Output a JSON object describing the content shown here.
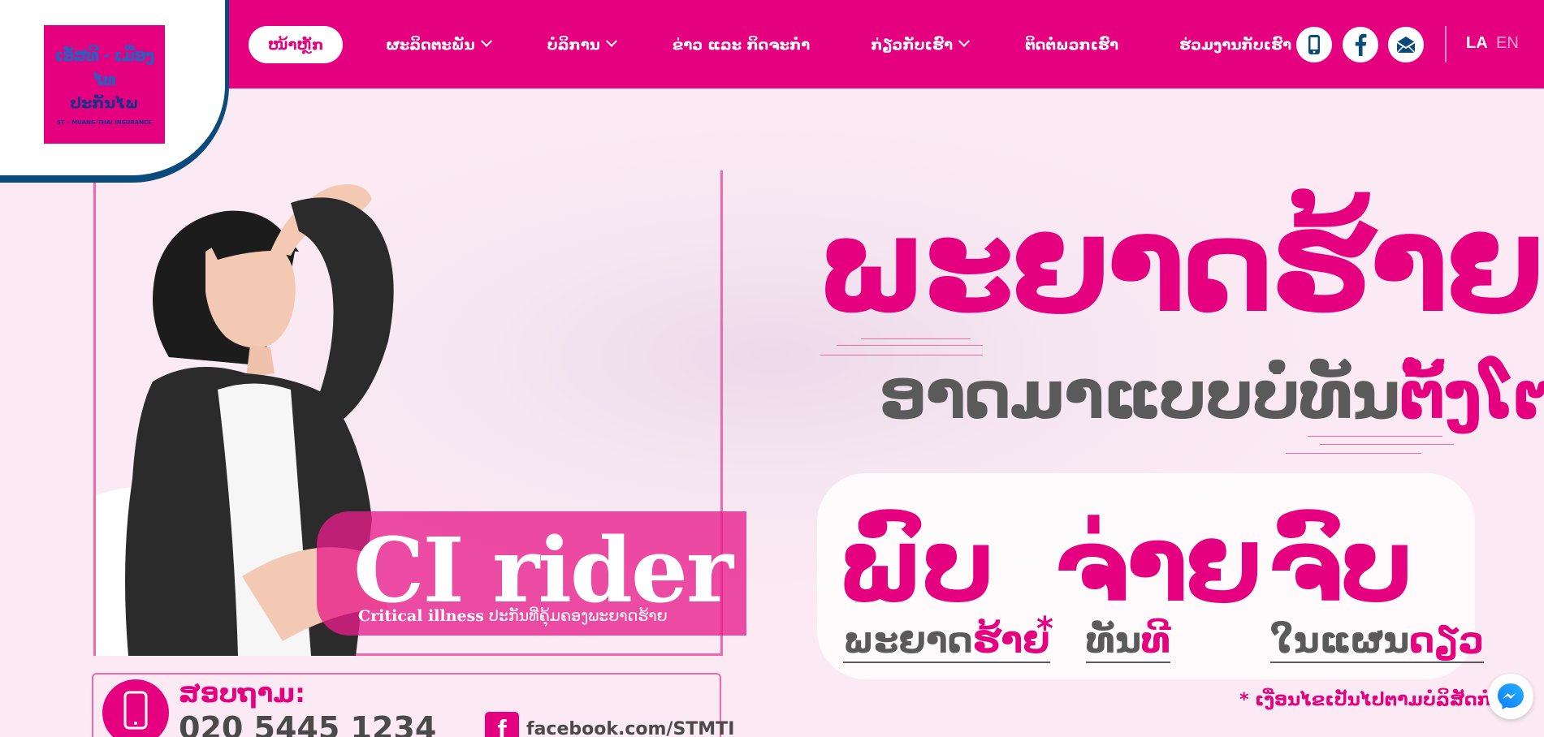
{
  "brand": {
    "logo_line1": "ເອັສທີ - ເມືອງໄທ",
    "logo_line2": "ປະກັນໄພ",
    "logo_line3": "ST – MUANG THAI INSURANCE"
  },
  "nav": {
    "items": [
      {
        "label": "ໜ້າຫຼັກ",
        "active": true,
        "dropdown": false
      },
      {
        "label": "ຜະລິດຕະພັນ",
        "active": false,
        "dropdown": true
      },
      {
        "label": "ບໍລິການ",
        "active": false,
        "dropdown": true
      },
      {
        "label": "ຂ່າວ ແລະ ກິດຈະກຳ",
        "active": false,
        "dropdown": false
      },
      {
        "label": "ກ່ຽວກັບເຮົາ",
        "active": false,
        "dropdown": true
      },
      {
        "label": "ຕິດຕໍ່ພວກເຮົາ",
        "active": false,
        "dropdown": false
      },
      {
        "label": "ຮ່ວມງານກັບເຮົາ",
        "active": false,
        "dropdown": false
      }
    ]
  },
  "social": {
    "icons": [
      "mobile-icon",
      "facebook-icon",
      "email-icon"
    ]
  },
  "language": {
    "la": "LA",
    "en": "EN",
    "selected": "LA"
  },
  "banner": {
    "headline": "ພະຍາດຮ້າຍ",
    "sub_head_gray": "ອາດມາແບບບໍ່ທັນ",
    "sub_head_pink": "ຕັ້ງໂຕ",
    "ci_title": "CI rider",
    "ci_sub_en": "Critical illness",
    "ci_sub_la": "ປະກັນທີ່ຄຸ້ມຄອງພະຍາດຮ້າຍ",
    "word1": "ພົບ",
    "word2": "ຈ່າຍ",
    "word3": "ຈົບ",
    "small1_gray": "ພະຍາດ",
    "small1_pink": "ຮ້າຍ",
    "star": "*",
    "small2_gray": "ທັນ",
    "small2_pink": "ທີ",
    "small3_gray": "ໃນແຜນ",
    "small3_pink": "ດຽວ",
    "note": "* ເງື່ອນໄຂເປັນໄປຕາມບໍລິສັດກຳນົດ",
    "contact_ask": "ສອບຖາມ:",
    "contact_phone": "020 5445 1234",
    "contact_fb": "facebook.com/STMTI"
  },
  "colors": {
    "brand_pink": "#e4007f",
    "logo_border": "#0b4a7c",
    "text_gray": "#5a5a5a"
  }
}
